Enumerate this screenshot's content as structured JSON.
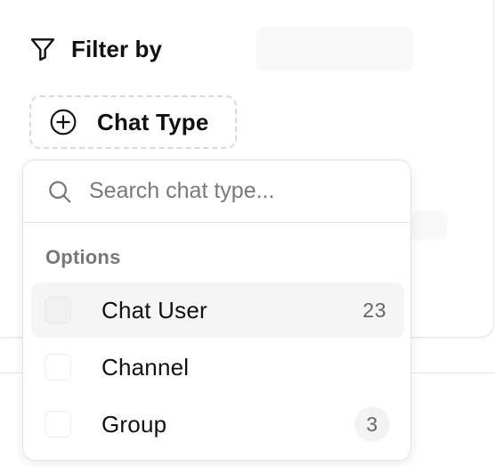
{
  "filter": {
    "title": "Filter by",
    "icon": "funnel-icon"
  },
  "chip": {
    "label": "Chat Type",
    "icon": "plus-circle-icon"
  },
  "popover": {
    "search_placeholder": "Search chat type...",
    "search_value": "",
    "group_label": "Options",
    "options": [
      {
        "label": "Chat User",
        "count": "23",
        "checked": false,
        "highlighted": true
      },
      {
        "label": "Channel",
        "count": "",
        "checked": false,
        "highlighted": false
      },
      {
        "label": "Group",
        "count": "3",
        "checked": false,
        "highlighted": false
      }
    ]
  },
  "colors": {
    "text": "#111111",
    "muted": "#777777",
    "border": "#e3e3e3",
    "highlight": "#f5f5f5"
  }
}
